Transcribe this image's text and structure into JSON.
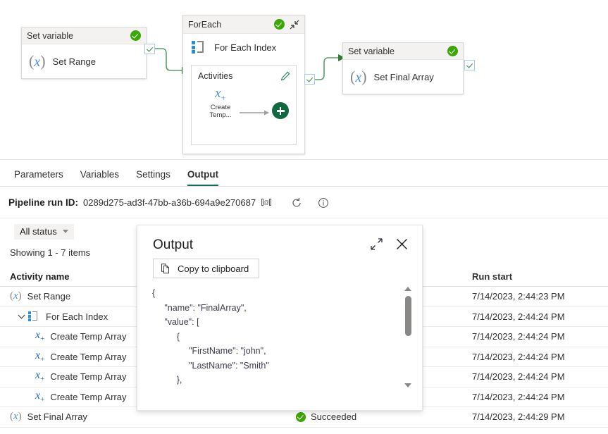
{
  "canvas": {
    "nodes": {
      "set_range": {
        "type_label": "Set variable",
        "name": "Set Range",
        "icon": "variable-x-icon",
        "status_icon": "success-check-icon"
      },
      "foreach": {
        "title": "ForEach",
        "status_icon": "success-check-icon",
        "collapse_icon": "collapse-diagonal-icon",
        "index_label": "For Each Index",
        "index_icon": "foreach-loop-icon",
        "activities_label": "Activities",
        "edit_icon": "pencil-icon",
        "inner_activity": "Create Temp...",
        "inner_activity_icon": "set-variable-plus-icon",
        "add_icon": "add-plus-circle-icon"
      },
      "set_final_array": {
        "type_label": "Set variable",
        "name": "Set Final Array",
        "icon": "variable-x-icon",
        "status_icon": "success-check-icon"
      }
    }
  },
  "tabs": [
    {
      "label": "Parameters",
      "active": false
    },
    {
      "label": "Variables",
      "active": false
    },
    {
      "label": "Settings",
      "active": false
    },
    {
      "label": "Output",
      "active": true
    }
  ],
  "run": {
    "label": "Pipeline run ID:",
    "id": "0289d275-ad3f-47bb-a36b-694a9e270687",
    "copy_icon": "copy-id-icon",
    "refresh_icon": "refresh-icon",
    "info_icon": "info-circle-icon"
  },
  "filter": {
    "status_label": "All status",
    "chevron_icon": "chevron-down-icon"
  },
  "grid": {
    "showing": "Showing 1 - 7 items",
    "columns": {
      "activity_name": "Activity name",
      "status": "",
      "run_start": "Run start"
    },
    "rows": [
      {
        "name": "Set Range",
        "icon": "variable-x-icon",
        "indent": "none",
        "expander": false,
        "status": "",
        "run_start": "7/14/2023, 2:44:23 PM"
      },
      {
        "name": "For Each Index",
        "icon": "foreach-loop-icon",
        "indent": "none",
        "expander": true,
        "status": "",
        "run_start": "7/14/2023, 2:44:24 PM"
      },
      {
        "name": "Create Temp Array",
        "icon": "set-variable-plus-icon",
        "indent": "child",
        "expander": false,
        "status": "",
        "run_start": "7/14/2023, 2:44:24 PM"
      },
      {
        "name": "Create Temp Array",
        "icon": "set-variable-plus-icon",
        "indent": "child",
        "expander": false,
        "status": "",
        "run_start": "7/14/2023, 2:44:24 PM"
      },
      {
        "name": "Create Temp Array",
        "icon": "set-variable-plus-icon",
        "indent": "child",
        "expander": false,
        "status": "",
        "run_start": "7/14/2023, 2:44:24 PM"
      },
      {
        "name": "Create Temp Array",
        "icon": "set-variable-plus-icon",
        "indent": "child",
        "expander": false,
        "status": "",
        "run_start": "7/14/2023, 2:44:24 PM"
      },
      {
        "name": "Set Final Array",
        "icon": "variable-x-icon",
        "indent": "none",
        "expander": false,
        "status": "Succeeded",
        "run_start": "7/14/2023, 2:44:29 PM"
      }
    ]
  },
  "dialog": {
    "title": "Output",
    "expand_icon": "expand-diagonal-icon",
    "close_icon": "close-x-icon",
    "copy_label": "Copy to clipboard",
    "copy_icon": "copy-icon",
    "json_text": "{\n     \"name\": \"FinalArray\",\n     \"value\": [\n          {\n               \"FirstName\": \"john\",\n               \"LastName\": \"Smith\"\n          },\n          {\n               \"FirstName\": \"henry\",",
    "scroll_up_icon": "scroll-up-arrow",
    "scroll_down_icon": "scroll-down-arrow"
  },
  "colors": {
    "success_green": "#3aa702",
    "accent_teal": "#0e6e5b",
    "variable_blue": "#4a90d9",
    "edge_green": "#5a9e69",
    "add_green": "#11693f"
  }
}
